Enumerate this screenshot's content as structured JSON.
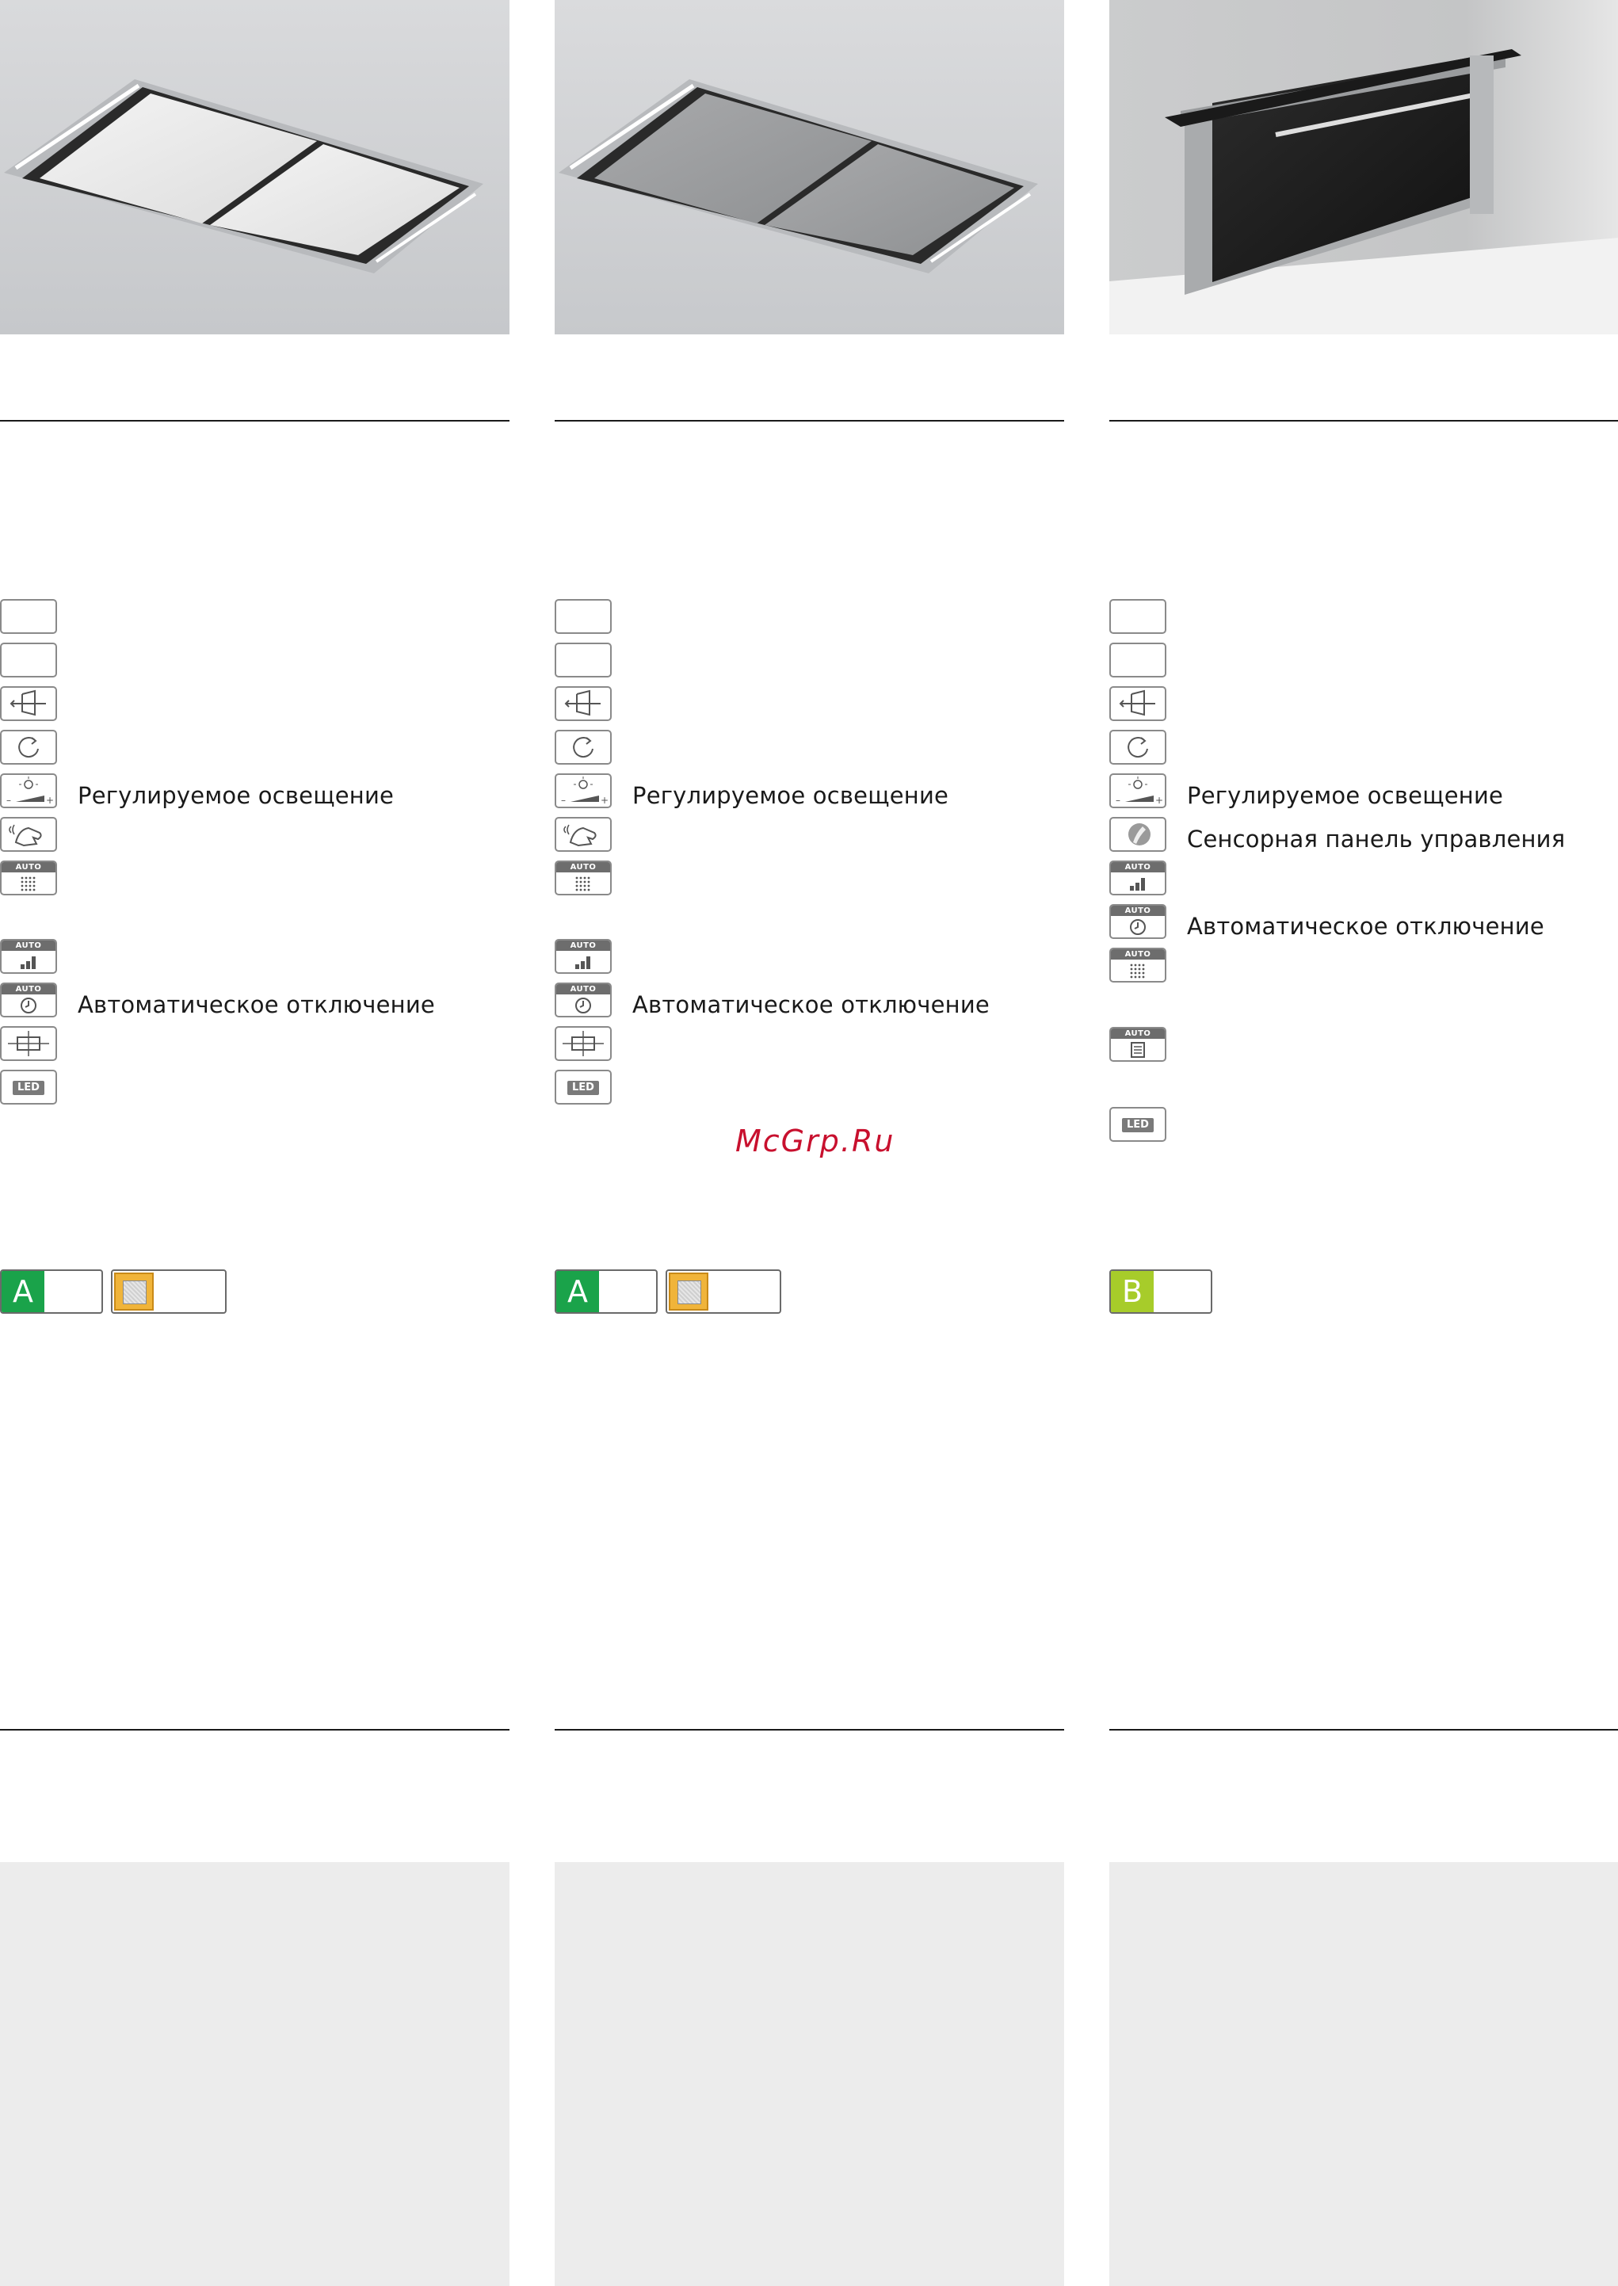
{
  "watermark": "McGrp.Ru",
  "columns": [
    {
      "photo": "ceiling-hood-white",
      "features": {
        "dimmable_light": "Регулируемое освещение",
        "auto_shutoff": "Автоматическое отключение"
      },
      "energy_class": "A",
      "energy_color": "#1aa34a",
      "has_filter_badge": true
    },
    {
      "photo": "ceiling-hood-grey",
      "features": {
        "dimmable_light": "Регулируемое освещение",
        "auto_shutoff": "Автоматическое отключение"
      },
      "energy_class": "A",
      "energy_color": "#1aa34a",
      "has_filter_badge": true
    },
    {
      "photo": "downdraft-hood-black",
      "features": {
        "dimmable_light": "Регулируемое освещение",
        "touch_panel": "Сенсорная панель управления",
        "auto_shutoff": "Автоматическое отключение"
      },
      "energy_class": "B",
      "energy_color": "#a7cc2a",
      "has_filter_badge": false
    }
  ],
  "icons": {
    "auto_label": "AUTO",
    "led_label": "LED"
  }
}
